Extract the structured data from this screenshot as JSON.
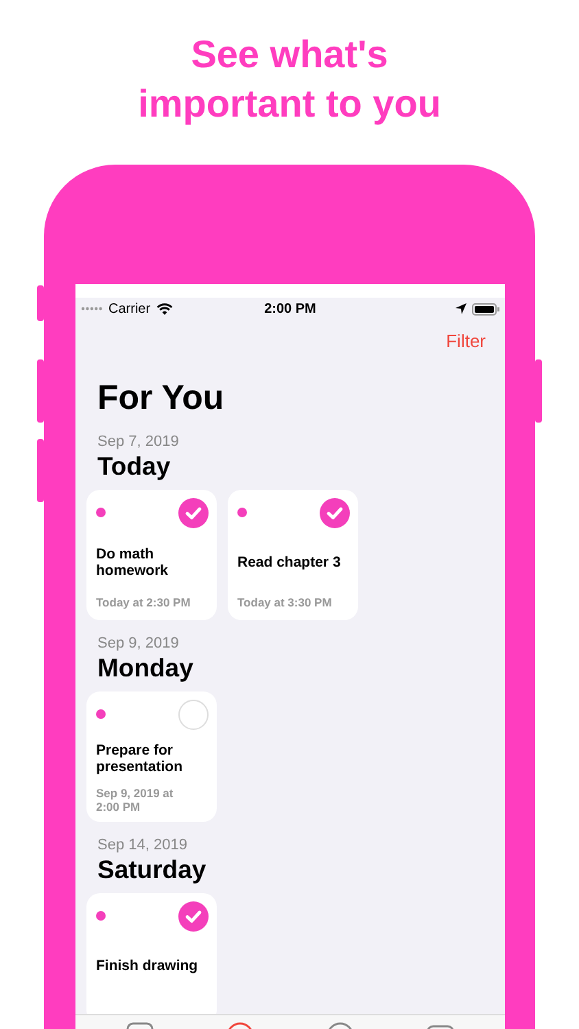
{
  "headline": [
    "See what's",
    "important to you"
  ],
  "status_bar": {
    "carrier": "Carrier",
    "time": "2:00 PM"
  },
  "nav": {
    "filter": "Filter",
    "title": "For You"
  },
  "sections": [
    {
      "date": "Sep 7, 2019",
      "day": "Today",
      "tasks": [
        {
          "title": "Do math homework",
          "due": "Today at 2:30 PM",
          "checked": true
        },
        {
          "title": "Read chapter 3",
          "due": "Today at 3:30 PM",
          "checked": true
        }
      ]
    },
    {
      "date": "Sep 9, 2019",
      "day": "Monday",
      "tasks": [
        {
          "title": "Prepare for presentation",
          "due": "Sep 9, 2019 at 2:00 PM",
          "checked": false
        }
      ]
    },
    {
      "date": "Sep 14, 2019",
      "day": "Saturday",
      "tasks": [
        {
          "title": "Finish drawing",
          "checked": true
        }
      ]
    }
  ],
  "tab_bar": [
    {
      "kind": "square",
      "selected": false
    },
    {
      "kind": "circle",
      "selected": true
    },
    {
      "kind": "circle",
      "selected": false
    },
    {
      "kind": "rect",
      "selected": false
    }
  ]
}
